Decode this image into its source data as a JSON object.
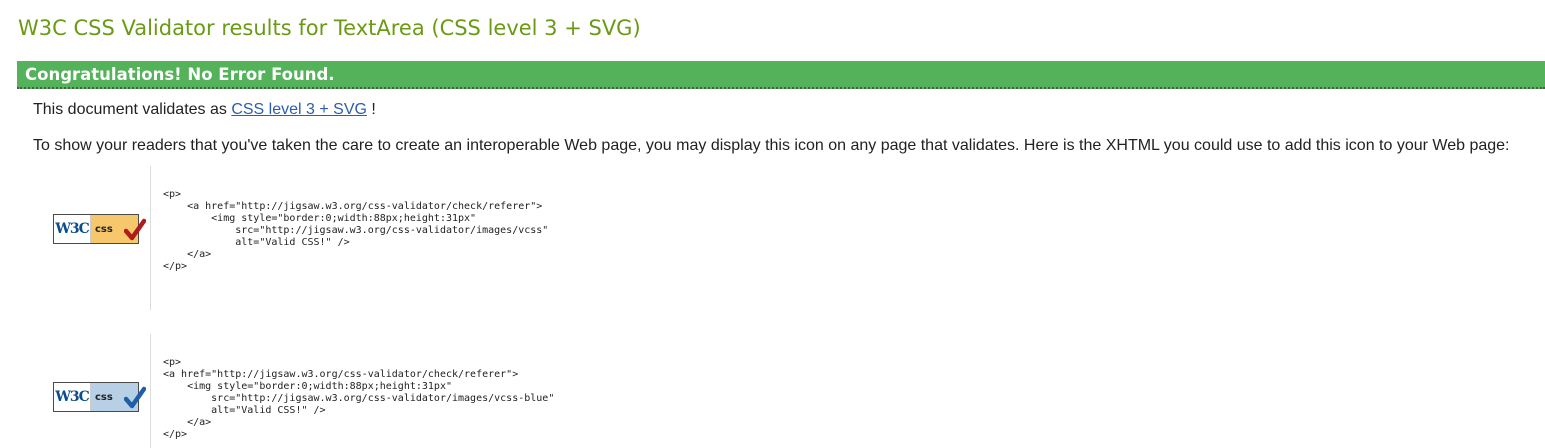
{
  "title": "W3C CSS Validator results for TextArea (CSS level 3 + SVG)",
  "banner": "Congratulations! No Error Found.",
  "validates": {
    "prefix": "This document validates as ",
    "link": "CSS level 3 + SVG",
    "suffix": " !"
  },
  "readers_text": "To show your readers that you've taken the care to create an interoperable Web page, you may display this icon on any page that validates. Here is the XHTML you could use to add this icon to your Web page:",
  "badges": [
    {
      "w3c": "W3C",
      "css": "css",
      "color": "#f6c76b",
      "check_color": "#b01c1c",
      "icon": "w3c-css-valid-gold-icon"
    },
    {
      "w3c": "W3C",
      "css": "css",
      "color": "#b7d0e6",
      "check_color": "#1f5fa8",
      "icon": "w3c-css-valid-blue-icon"
    }
  ],
  "code_snippets": [
    "<p>\n    <a href=\"http://jigsaw.w3.org/css-validator/check/referer\">\n        <img style=\"border:0;width:88px;height:31px\"\n            src=\"http://jigsaw.w3.org/css-validator/images/vcss\"\n            alt=\"Valid CSS!\" />\n    </a>\n</p>",
    "<p>\n<a href=\"http://jigsaw.w3.org/css-validator/check/referer\">\n    <img style=\"border:0;width:88px;height:31px\"\n        src=\"http://jigsaw.w3.org/css-validator/images/vcss-blue\"\n        alt=\"Valid CSS!\" />\n    </a>\n</p>"
  ]
}
